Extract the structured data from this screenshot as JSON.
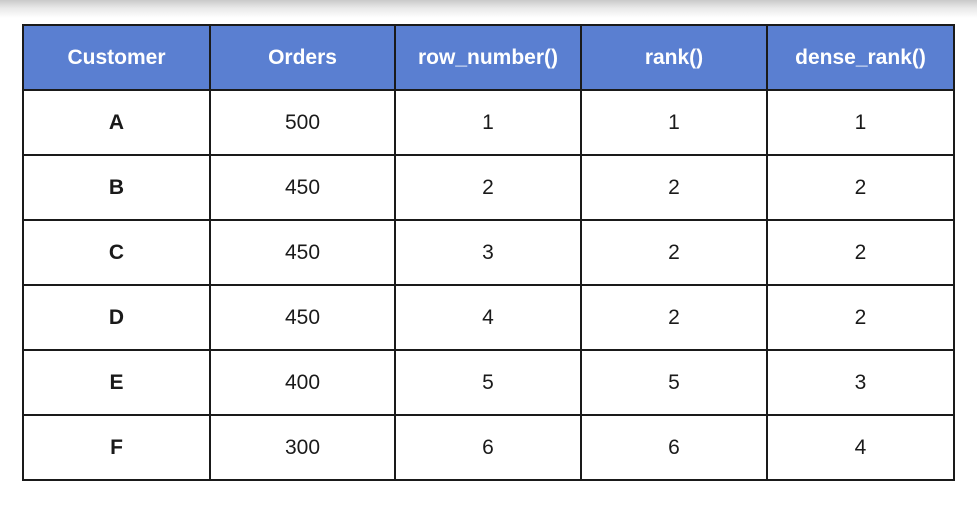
{
  "table": {
    "headers": [
      "Customer",
      "Orders",
      "row_number()",
      "rank()",
      "dense_rank()"
    ],
    "rows": [
      [
        "A",
        "500",
        "1",
        "1",
        "1"
      ],
      [
        "B",
        "450",
        "2",
        "2",
        "2"
      ],
      [
        "C",
        "450",
        "3",
        "2",
        "2"
      ],
      [
        "D",
        "450",
        "4",
        "2",
        "2"
      ],
      [
        "E",
        "400",
        "5",
        "5",
        "3"
      ],
      [
        "F",
        "300",
        "6",
        "6",
        "4"
      ]
    ]
  },
  "colors": {
    "header_bg": "#5a7fd1",
    "header_text": "#ffffff",
    "border": "#1a1a1a"
  }
}
